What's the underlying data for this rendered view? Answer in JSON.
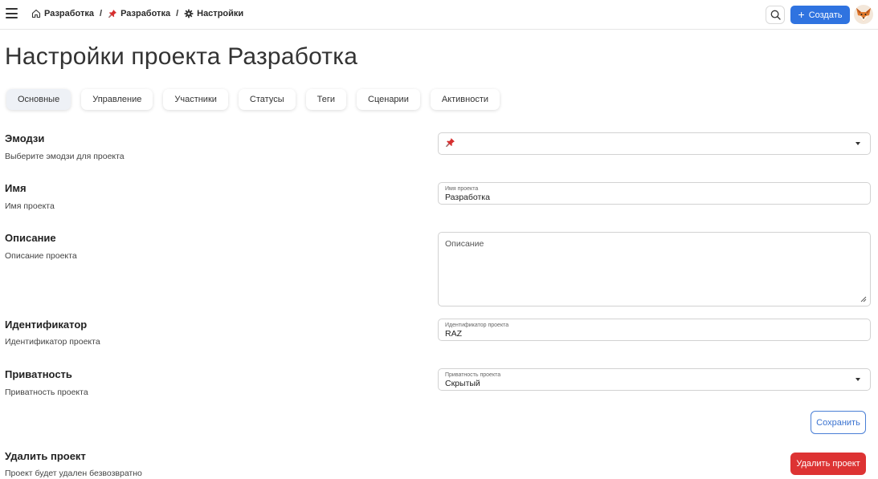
{
  "breadcrumb": {
    "items": [
      {
        "label": "Разработка",
        "icon": "home-icon"
      },
      {
        "label": "Разработка",
        "icon": "pushpin-icon"
      },
      {
        "label": "Настройки",
        "icon": "gear-icon"
      }
    ],
    "separator": "/"
  },
  "header": {
    "create_label": "Создать",
    "create_icon": "+",
    "accent_color": "#2f73e0"
  },
  "page": {
    "title": "Настройки проекта Разработка"
  },
  "tabs": [
    {
      "label": "Основные",
      "active": true
    },
    {
      "label": "Управление",
      "active": false
    },
    {
      "label": "Участники",
      "active": false
    },
    {
      "label": "Статусы",
      "active": false
    },
    {
      "label": "Теги",
      "active": false
    },
    {
      "label": "Сценарии",
      "active": false
    },
    {
      "label": "Активности",
      "active": false
    }
  ],
  "settings": {
    "emoji": {
      "title": "Эмодзи",
      "description": "Выберите эмодзи для проекта",
      "value": "📌"
    },
    "name": {
      "title": "Имя",
      "description": "Имя проекта",
      "field_label": "Имя проекта",
      "value": "Разработка"
    },
    "description": {
      "title": "Описание",
      "description": "Описание проекта",
      "placeholder": "Описание",
      "value": ""
    },
    "identifier": {
      "title": "Идентификатор",
      "description": "Идентификатор проекта",
      "field_label": "Идентификатор проекта",
      "value": "RAZ"
    },
    "privacy": {
      "title": "Приватность",
      "description": "Приватность проекта",
      "field_label": "Приватность проекта",
      "value": "Скрытый"
    }
  },
  "actions": {
    "save_label": "Сохранить",
    "delete": {
      "title": "Удалить проект",
      "description": "Проект будет удален безвозвратно",
      "button_label": "Удалить проект",
      "color": "#dd3333"
    }
  }
}
